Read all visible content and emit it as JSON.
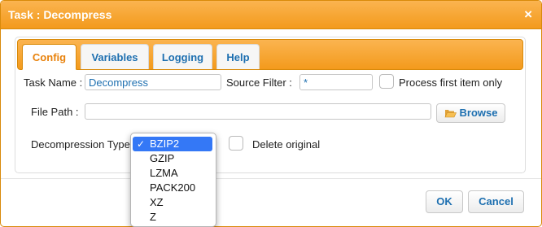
{
  "dialog": {
    "title": "Task : Decompress",
    "close_glyph": "×"
  },
  "tabs": [
    {
      "label": "Config",
      "active": true
    },
    {
      "label": "Variables",
      "active": false
    },
    {
      "label": "Logging",
      "active": false
    },
    {
      "label": "Help",
      "active": false
    }
  ],
  "form": {
    "task_name_label": "Task Name :",
    "task_name_value": "Decompress",
    "source_filter_label": "Source Filter :",
    "source_filter_value": "*",
    "process_first_label": "Process first item only",
    "process_first_checked": false,
    "file_path_label": "File Path :",
    "file_path_value": "",
    "browse_label": "Browse",
    "browse_icon": "folder-open-icon",
    "decompression_type_label": "Decompression Type",
    "delete_original_label": "Delete original",
    "delete_original_checked": false
  },
  "decompression_options": [
    "BZIP2",
    "GZIP",
    "LZMA",
    "PACK200",
    "XZ",
    "Z"
  ],
  "decompression_selected": "BZIP2",
  "check_glyph": "✓",
  "footer": {
    "ok_label": "OK",
    "cancel_label": "Cancel"
  },
  "colors": {
    "accent_orange": "#f39a1c",
    "link_blue": "#1d6fb0",
    "selection_blue": "#3478f6"
  }
}
